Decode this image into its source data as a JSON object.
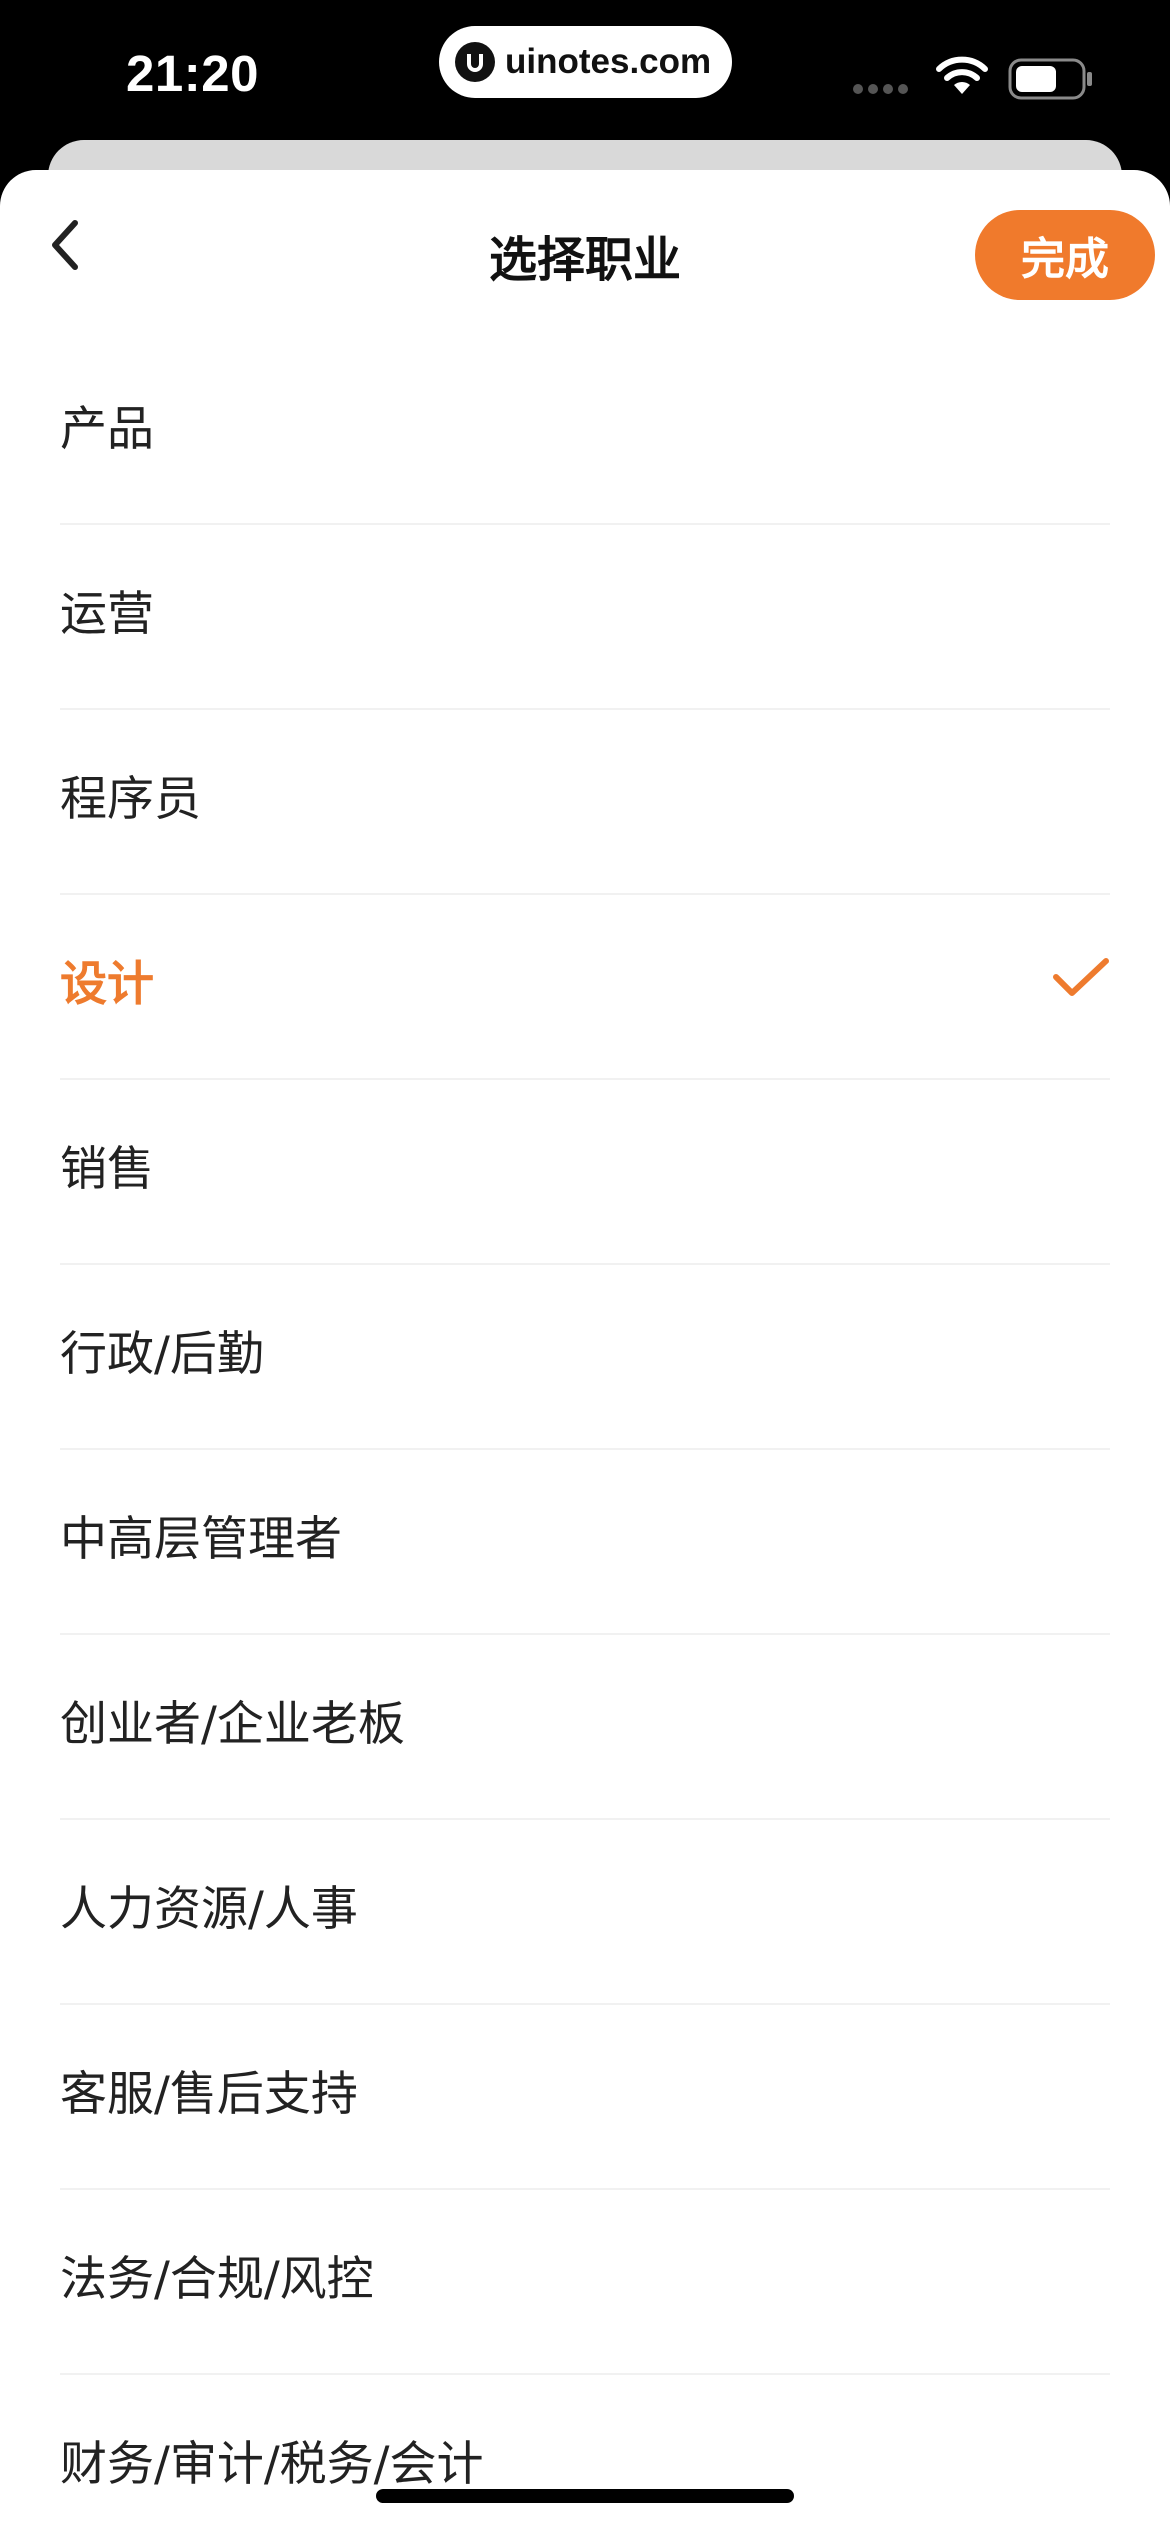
{
  "status_bar": {
    "time": "21:20",
    "watermark": "uinotes.com"
  },
  "header": {
    "back_icon": "chevron-left-icon",
    "title": "选择职业",
    "done_label": "完成"
  },
  "colors": {
    "accent": "#ee7b2e",
    "done_button": "#f07a2c",
    "text": "#222222",
    "divider": "#f1f1f1"
  },
  "occupations": [
    {
      "label": "产品",
      "selected": false
    },
    {
      "label": "运营",
      "selected": false
    },
    {
      "label": "程序员",
      "selected": false
    },
    {
      "label": "设计",
      "selected": true
    },
    {
      "label": "销售",
      "selected": false
    },
    {
      "label": "行政/后勤",
      "selected": false
    },
    {
      "label": "中高层管理者",
      "selected": false
    },
    {
      "label": "创业者/企业老板",
      "selected": false
    },
    {
      "label": "人力资源/人事",
      "selected": false
    },
    {
      "label": "客服/售后支持",
      "selected": false
    },
    {
      "label": "法务/合规/风控",
      "selected": false
    },
    {
      "label": "财务/审计/税务/会计",
      "selected": false
    }
  ]
}
